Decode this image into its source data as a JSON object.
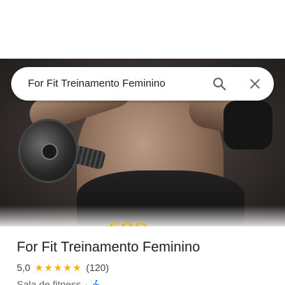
{
  "search": {
    "query": "For Fit Treinamento Feminino",
    "search_icon": "search-icon",
    "close_icon": "close-icon"
  },
  "hero": {
    "image": "gym-woman-dumbbell-photo",
    "logo_peek_text": "FOR"
  },
  "place": {
    "name": "For Fit Treinamento Feminino",
    "rating": "5,0",
    "stars": 5,
    "review_count": "(120)",
    "category": "Sala de fitness",
    "separator": "·",
    "accessibility_icon": "wheelchair-accessible-icon"
  },
  "colors": {
    "star": "#f4b400",
    "text_primary": "#202124",
    "text_secondary": "#5f6368",
    "accessibility": "#1a73e8"
  }
}
